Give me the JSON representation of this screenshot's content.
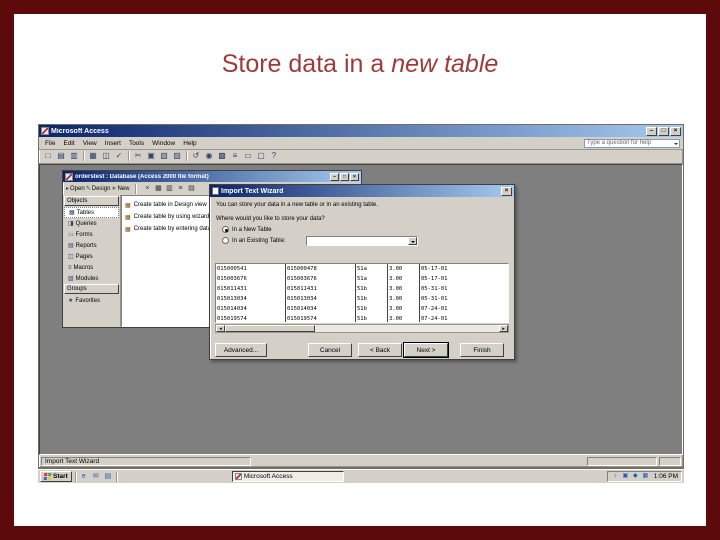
{
  "slide": {
    "title_prefix": "Store data in a ",
    "title_emphasis": "new table"
  },
  "colors": {
    "frame": "#5c0a0a",
    "title": "#9e3a3a",
    "tb1": "#0a246a",
    "tb2": "#a6caf0",
    "chrome": "#d4d0c8",
    "desktop": "#7f7f7f"
  },
  "access_window": {
    "title": "Microsoft Access",
    "window_controls": [
      {
        "name": "minimize-button",
        "glyph": "–"
      },
      {
        "name": "restore-button",
        "glyph": "□"
      },
      {
        "name": "close-button",
        "glyph": "×"
      }
    ],
    "menu_items": [
      "File",
      "Edit",
      "View",
      "Insert",
      "Tools",
      "Window",
      "Help"
    ],
    "help_prompt": "Type a question for help",
    "toolbar_icons": [
      {
        "name": "new-icon",
        "glyph": "□"
      },
      {
        "name": "open-icon",
        "glyph": "▤"
      },
      {
        "name": "save-icon",
        "glyph": "▥"
      },
      {
        "name": "separator"
      },
      {
        "name": "print-icon",
        "glyph": "▦"
      },
      {
        "name": "print-preview-icon",
        "glyph": "◫"
      },
      {
        "name": "spelling-icon",
        "glyph": "✓"
      },
      {
        "name": "separator"
      },
      {
        "name": "cut-icon",
        "glyph": "✂"
      },
      {
        "name": "copy-icon",
        "glyph": "▣"
      },
      {
        "name": "paste-icon",
        "glyph": "▧"
      },
      {
        "name": "format-painter-icon",
        "glyph": "▨"
      },
      {
        "name": "separator"
      },
      {
        "name": "undo-icon",
        "glyph": "↺"
      },
      {
        "name": "hyperlink-icon",
        "glyph": "◉"
      },
      {
        "name": "analyze-icon",
        "glyph": "▩"
      },
      {
        "name": "code-icon",
        "glyph": "≡"
      },
      {
        "name": "properties-icon",
        "glyph": "▭"
      },
      {
        "name": "new-object-icon",
        "glyph": "▢"
      },
      {
        "name": "help-icon",
        "glyph": "?"
      }
    ],
    "status_text": "Import Text Wizard"
  },
  "db_window": {
    "title": "orderstest : Database (Access 2000 file format)",
    "window_controls": [
      {
        "name": "db-minimize-button",
        "glyph": "–"
      },
      {
        "name": "db-restore-button",
        "glyph": "□"
      },
      {
        "name": "db-close-button",
        "glyph": "×"
      }
    ],
    "toolbar_buttons": [
      {
        "label": "Open",
        "glyph": "▸"
      },
      {
        "label": "Design",
        "glyph": "✎"
      },
      {
        "label": "New",
        "glyph": "∗"
      }
    ],
    "toolbar_icons": [
      {
        "name": "delete-icon",
        "glyph": "×"
      },
      {
        "name": "large-icons-icon",
        "glyph": "▦"
      },
      {
        "name": "small-icons-icon",
        "glyph": "▥"
      },
      {
        "name": "list-view-icon",
        "glyph": "≡"
      },
      {
        "name": "details-view-icon",
        "glyph": "▤"
      }
    ],
    "objects_header": "Objects",
    "selected_object": "Tables",
    "object_items": [
      {
        "label": "Tables",
        "glyph": "▦"
      },
      {
        "label": "Queries",
        "glyph": "◨"
      },
      {
        "label": "Forms",
        "glyph": "▭"
      },
      {
        "label": "Reports",
        "glyph": "▤"
      },
      {
        "label": "Pages",
        "glyph": "◫"
      },
      {
        "label": "Macros",
        "glyph": "≡"
      },
      {
        "label": "Modules",
        "glyph": "▧"
      }
    ],
    "groups_header": "Groups",
    "group_items": [
      {
        "label": "Favorites",
        "glyph": "★"
      }
    ],
    "list_item_glyph": "▦",
    "list_items": [
      "Create table in Design view",
      "Create table by using wizard",
      "Create table by entering data"
    ]
  },
  "wizard": {
    "title": "Import Text Wizard",
    "close_glyph": "×",
    "intro": "You can store your data in a new table or in an existing table.",
    "question": "Where would you like to store your data?",
    "option_new": "In a New Table",
    "option_existing": "In an Existing Table:",
    "scroll_left_glyph": "◂",
    "scroll_right_glyph": "▸",
    "buttons": {
      "advanced": "Advanced...",
      "cancel": "Cancel",
      "back": "< Back",
      "next": "Next >",
      "finish": "Finish"
    },
    "grid_rows": [
      [
        "015000541",
        "015000478",
        "51a",
        "3.00",
        "05-17-01"
      ],
      [
        "015003676",
        "015003676",
        "51a",
        "3.00",
        "05-17-01"
      ],
      [
        "015011431",
        "015011431",
        "51b",
        "3.00",
        "05-31-01"
      ],
      [
        "015013034",
        "015013034",
        "51b",
        "3.00",
        "05-31-01"
      ],
      [
        "015014034",
        "015014034",
        "51b",
        "3.00",
        "07-24-01"
      ],
      [
        "015019574",
        "015019574",
        "51b",
        "3.00",
        "07-24-01"
      ]
    ]
  },
  "taskbar": {
    "start_label": "Start",
    "quick_launch_icons": [
      {
        "name": "internet-explorer-icon",
        "glyph": "e"
      },
      {
        "name": "outlook-icon",
        "glyph": "✉"
      },
      {
        "name": "show-desktop-icon",
        "glyph": "▤"
      }
    ],
    "task_label": "Microsoft Access",
    "tray_icons": [
      {
        "name": "volume-icon",
        "glyph": "♪"
      },
      {
        "name": "display-icon",
        "glyph": "▣"
      },
      {
        "name": "antivirus-icon",
        "glyph": "◆"
      },
      {
        "name": "network-icon",
        "glyph": "▦"
      }
    ],
    "clock": "1:06 PM"
  }
}
